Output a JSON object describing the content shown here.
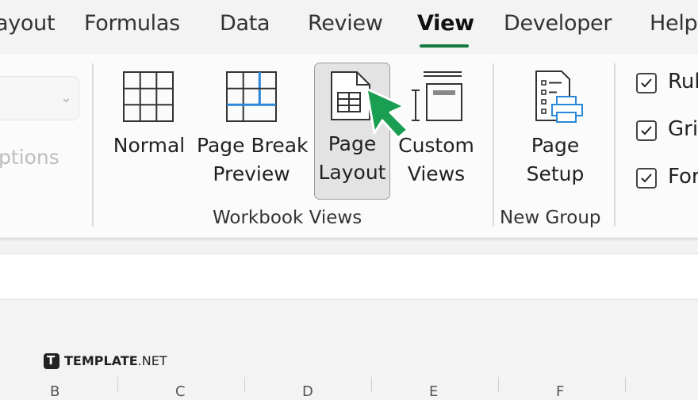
{
  "tabs": [
    {
      "label": "ayout"
    },
    {
      "label": "Formulas"
    },
    {
      "label": "Data"
    },
    {
      "label": "Review"
    },
    {
      "label": "View"
    },
    {
      "label": "Developer"
    },
    {
      "label": "Help"
    }
  ],
  "active_tab": "View",
  "ribbon": {
    "options_label": "ptions",
    "workbook_views": {
      "group_label": "Workbook Views",
      "buttons": [
        {
          "line1": "Normal",
          "line2": ""
        },
        {
          "line1": "Page Break",
          "line2": "Preview"
        },
        {
          "line1": "Page",
          "line2": "Layout"
        },
        {
          "line1": "Custom",
          "line2": "Views"
        }
      ]
    },
    "new_group": {
      "group_label": "New Group",
      "buttons": [
        {
          "line1": "Page",
          "line2": "Setup"
        }
      ]
    },
    "show_checks": [
      {
        "label": "Rul",
        "checked": true
      },
      {
        "label": "Grid",
        "checked": true
      },
      {
        "label": "For",
        "checked": true
      }
    ]
  },
  "columns": [
    "B",
    "C",
    "D",
    "E",
    "F"
  ],
  "watermark": {
    "brand": "TEMPLATE",
    "suffix": ".NET",
    "logo_letter": "T"
  },
  "colors": {
    "accent": "#127a3e",
    "cursor": "#1a9e52",
    "icon_blue": "#2b88d8"
  }
}
